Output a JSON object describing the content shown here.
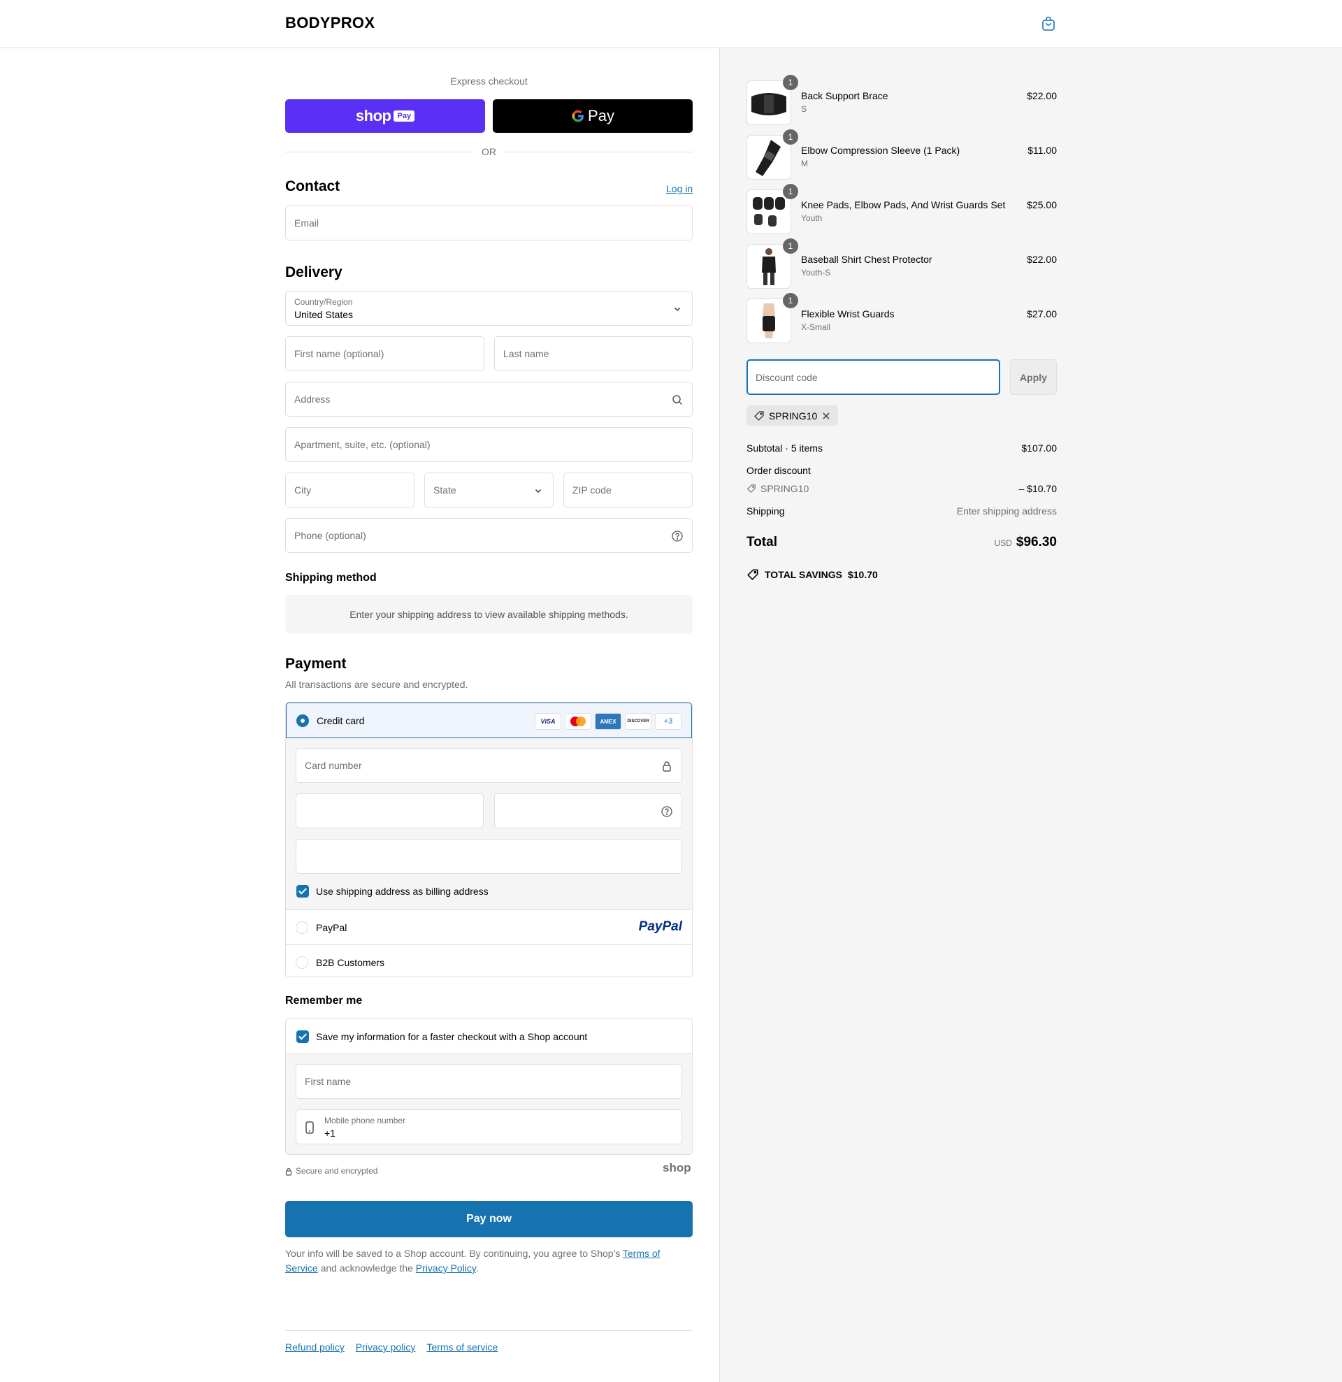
{
  "header": {
    "brand": "BODYPROX"
  },
  "express": {
    "label": "Express checkout",
    "shop_word": "shop",
    "shop_badge": "Pay",
    "gpay_word": "Pay",
    "or": "OR"
  },
  "contact": {
    "title": "Contact",
    "login": "Log in",
    "email_placeholder": "Email"
  },
  "delivery": {
    "title": "Delivery",
    "country_label": "Country/Region",
    "country_value": "United States",
    "first_name": "First name (optional)",
    "last_name": "Last name",
    "address": "Address",
    "apartment": "Apartment, suite, etc. (optional)",
    "city": "City",
    "state": "State",
    "zip": "ZIP code",
    "phone": "Phone (optional)"
  },
  "shipping_method": {
    "title": "Shipping method",
    "note": "Enter your shipping address to view available shipping methods."
  },
  "payment": {
    "title": "Payment",
    "subtitle": "All transactions are secure and encrypted.",
    "credit_card": "Credit card",
    "cards": [
      "VISA",
      "",
      "AMEX",
      "DISCOVER",
      "+3"
    ],
    "card_number": "Card number",
    "billing_same": "Use shipping address as billing address",
    "paypal": "PayPal",
    "paypal_logo": "PayPal",
    "b2b": "B2B Customers"
  },
  "remember": {
    "title": "Remember me",
    "save_info": "Save my information for a faster checkout with a Shop account",
    "first_name": "First name",
    "mobile_label": "Mobile phone number",
    "mobile_value": "+1",
    "secure": "Secure and encrypted",
    "shop_logo": "shop"
  },
  "pay_now": "Pay now",
  "legal": {
    "text1": "Your info will be saved to a Shop account. By continuing, you agree to Shop's ",
    "terms": "Terms of Service",
    "text2": " and acknowledge the ",
    "privacy": "Privacy Policy",
    "text3": "."
  },
  "footer": {
    "refund": "Refund policy",
    "privacy": "Privacy policy",
    "terms": "Terms of service"
  },
  "summary": {
    "items": [
      {
        "name": "Back Support Brace",
        "variant": "S",
        "price": "$22.00",
        "qty": "1"
      },
      {
        "name": "Elbow Compression Sleeve (1 Pack)",
        "variant": "M",
        "price": "$11.00",
        "qty": "1"
      },
      {
        "name": "Knee Pads, Elbow Pads, And Wrist Guards Set",
        "variant": "Youth",
        "price": "$25.00",
        "qty": "1"
      },
      {
        "name": "Baseball Shirt Chest Protector",
        "variant": "Youth-S",
        "price": "$22.00",
        "qty": "1"
      },
      {
        "name": "Flexible Wrist Guards",
        "variant": "X-Small",
        "price": "$27.00",
        "qty": "1"
      }
    ],
    "discount_placeholder": "Discount code",
    "apply": "Apply",
    "applied_code": "SPRING10",
    "subtotal_label": "Subtotal · 5 items",
    "subtotal_value": "$107.00",
    "order_discount_label": "Order discount",
    "discount_code": "SPRING10",
    "discount_value": "– $10.70",
    "shipping_label": "Shipping",
    "shipping_value": "Enter shipping address",
    "total_label": "Total",
    "currency": "USD",
    "total_value": "$96.30",
    "savings_label": "TOTAL SAVINGS",
    "savings_value": "$10.70"
  },
  "colors": {
    "accent": "#1773b0",
    "shop_purple": "#5a31f4"
  }
}
